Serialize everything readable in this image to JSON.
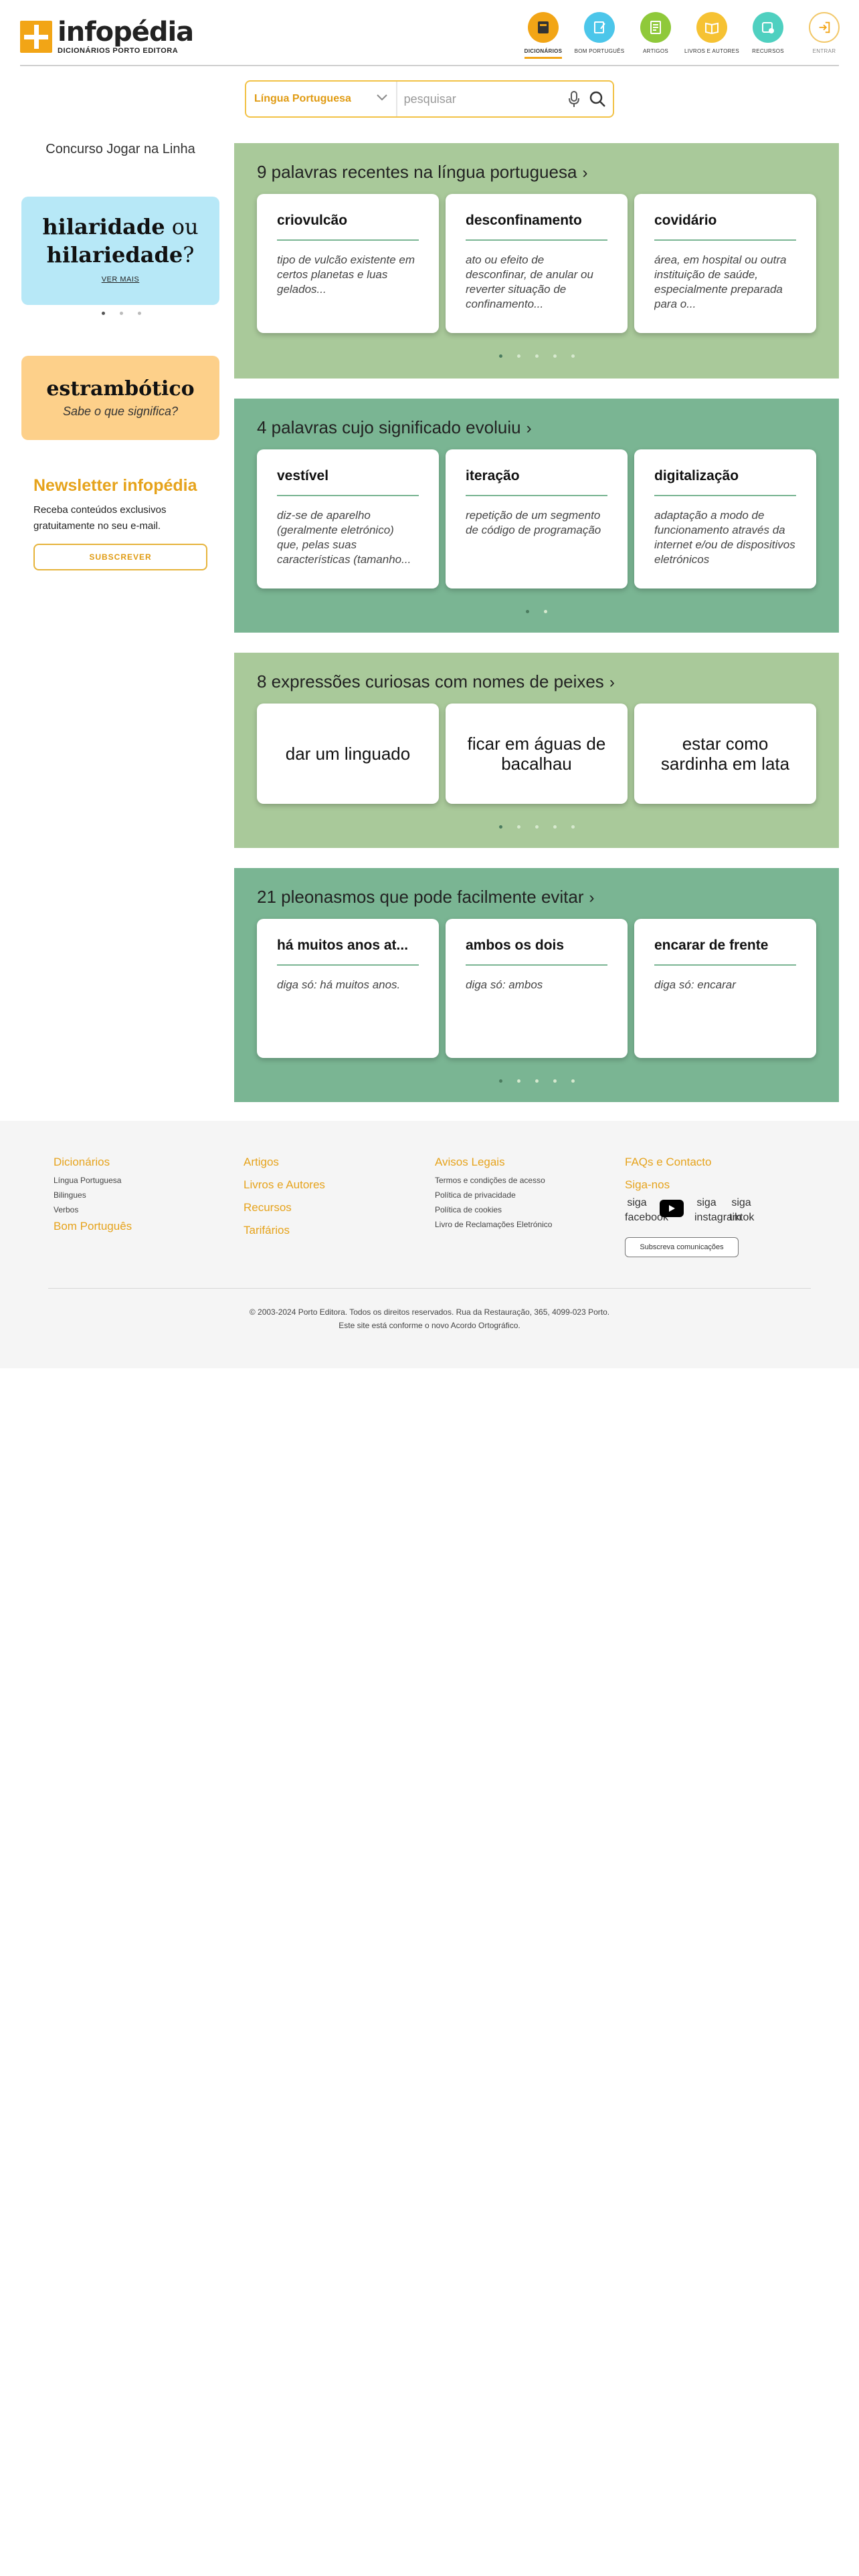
{
  "brand": {
    "name": "infopédia",
    "subtitle": "DICIONÁRIOS PORTO EDITORA",
    "accent": "#f2a516"
  },
  "nav": [
    {
      "label": "DICIONÁRIOS",
      "icon": "dictionary-icon",
      "color": "#f2a516",
      "active": true
    },
    {
      "label": "BOM PORTUGUÊS",
      "icon": "notebook-icon",
      "color": "#4cc6ea"
    },
    {
      "label": "ARTIGOS",
      "icon": "article-icon",
      "color": "#8fc93a"
    },
    {
      "label": "LIVROS E AUTORES",
      "icon": "books-icon",
      "color": "#f6c233"
    },
    {
      "label": "RECURSOS",
      "icon": "resources-icon",
      "color": "#4fd0c0"
    },
    {
      "label": "ENTRAR",
      "icon": "login-icon",
      "color": "#ffffff"
    }
  ],
  "search": {
    "dictionary": "Língua Portuguesa",
    "placeholder": "pesquisar"
  },
  "sidebar": {
    "ad_alt": "Concurso Jogar na Linha",
    "word_card": {
      "word1": "hilaridade",
      "or": "ou",
      "word2": "hilariedade",
      "q": "?",
      "link": "VER MAIS"
    },
    "orange_card": {
      "word": "estrambótico",
      "sub": "Sabe o que significa?"
    },
    "newsletter": {
      "title": "Newsletter infopédia",
      "text": "Receba conteúdos exclusivos gratuitamente no seu e-mail.",
      "button": "SUBSCREVER"
    }
  },
  "sections": [
    {
      "title": "9 palavras recentes na língua portuguesa",
      "cards": [
        {
          "word": "criovulcão",
          "def": "tipo de vulcão existente em certos planetas e luas gelados..."
        },
        {
          "word": "desconfinamento",
          "def": "ato ou efeito de desconfinar, de anular ou reverter situação de confinamento..."
        },
        {
          "word": "covidário",
          "def": "área, em hospital ou outra instituição de saúde, especialmente preparada para o..."
        }
      ]
    },
    {
      "title": "4 palavras cujo significado evoluiu",
      "cards": [
        {
          "word": "vestível",
          "def": "diz-se de aparelho (geralmente eletrónico) que, pelas suas características (tamanho..."
        },
        {
          "word": "iteração",
          "def": "repetição de um segmento de código de programação"
        },
        {
          "word": "digitalização",
          "def": "adaptação a modo de funcionamento através da internet e/ou de dispositivos eletrónicos"
        }
      ]
    },
    {
      "title": "8 expressões curiosas com nomes de peixes",
      "cards": [
        {
          "text": "dar um linguado"
        },
        {
          "text": "ficar em águas de bacalhau"
        },
        {
          "text": "estar como sardinha em lata"
        }
      ]
    },
    {
      "title": "21 pleonasmos que pode facilmente evitar",
      "cards": [
        {
          "word": "há muitos anos at...",
          "def": "diga só: há muitos anos."
        },
        {
          "word": "ambos os dois",
          "def": "diga só: ambos"
        },
        {
          "word": "encarar de frente",
          "def": "diga só: encarar"
        }
      ]
    }
  ],
  "footer": {
    "col1": {
      "head": "Dicionários",
      "links": [
        "Língua Portuguesa",
        "Bilingues",
        "Verbos"
      ],
      "head2": "Bom Português"
    },
    "col2": {
      "head": "Artigos",
      "links2": [
        "Livros e Autores",
        "Recursos",
        "Tarifários"
      ]
    },
    "col3": {
      "head": "Avisos Legais",
      "links": [
        "Termos e condições de acesso",
        "Política de privacidade",
        "Política de cookies",
        "Livro de Reclamações Eletrónico"
      ]
    },
    "col4": {
      "head": "FAQs e Contacto",
      "head2": "Siga-nos",
      "social": [
        "siga facebook",
        "siga instagram",
        "siga tiktok"
      ],
      "button": "Subscreva comunicações"
    },
    "copyright1": "© 2003-2024 Porto Editora. Todos os direitos reservados. Rua da Restauração, 365, 4099-023 Porto.",
    "copyright2": "Este site está conforme o novo Acordo Ortográfico."
  }
}
